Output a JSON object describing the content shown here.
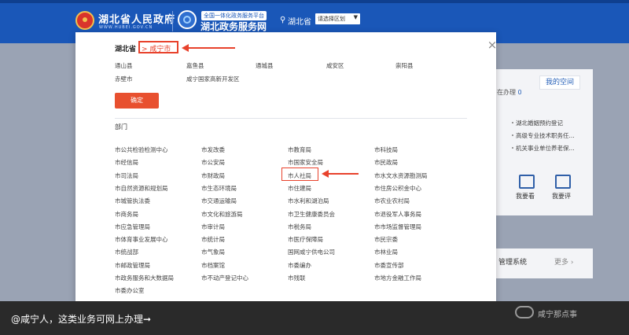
{
  "header": {
    "gov_title": "湖北省人民政府",
    "gov_url": "WWW.HUBEI.GOV.CN",
    "svc_small": "全国一体化政务服务平台",
    "svc_title": "湖北政务服务网",
    "location": "湖北省",
    "region_select": "请选择区划",
    "brand_color": "#1a57b8"
  },
  "background": {
    "tab_space": "我的空间",
    "online_prefix": "在办理",
    "online_count": "0",
    "items": [
      "湖北婚姻预约登记",
      "高级专业技术职务任...",
      "机关事业单位养老保..."
    ],
    "icon_see": "我要看",
    "icon_review": "我要评",
    "mgmt": "管理系统",
    "more": "更多 ›"
  },
  "modal": {
    "close_icon": "×",
    "breadcrumb_province": "湖北省",
    "breadcrumb_city": "> 咸宁市",
    "counties": [
      "通山县",
      "嘉鱼县",
      "通城县",
      "咸安区",
      "崇阳县",
      "赤壁市",
      "咸宁国家高新开发区"
    ],
    "confirm": "确定",
    "dept_title": "部门",
    "departments": [
      [
        "市公共检验检测中心",
        "市发改委",
        "市教育局",
        "市科技局"
      ],
      [
        "市经信局",
        "市公安局",
        "市国家安全局",
        "市民政局"
      ],
      [
        "市司法局",
        "市财政局",
        "市人社局",
        "市水文水资源勘测局"
      ],
      [
        "市自然资源和规划局",
        "市生态环境局",
        "市住建局",
        "市住房公积金中心"
      ],
      [
        "市城管执法委",
        "市交通运输局",
        "市水利和湖泊局",
        "市农业农村局"
      ],
      [
        "市商务局",
        "市文化和旅游局",
        "市卫生健康委员会",
        "市退役军人事务局"
      ],
      [
        "市应急管理局",
        "市审计局",
        "市税务局",
        "市市场监督管理局"
      ],
      [
        "市体育事业发展中心",
        "市统计局",
        "市医疗保障局",
        "市民宗委"
      ],
      [
        "市统战部",
        "市气象局",
        "国网咸宁供电公司",
        "市林业局"
      ],
      [
        "市邮政管理局",
        "市档案馆",
        "市委编办",
        "市委宣传部"
      ],
      [
        "市政务服务和大数据局",
        "市不动产登记中心",
        "市残联",
        "市地方金融工作局"
      ],
      [
        "市委办公室"
      ]
    ],
    "accent_color": "#e8422c"
  },
  "caption": {
    "text": "@咸宁人，这类业务可网上办理➞",
    "watermark": "咸宁那点事"
  }
}
